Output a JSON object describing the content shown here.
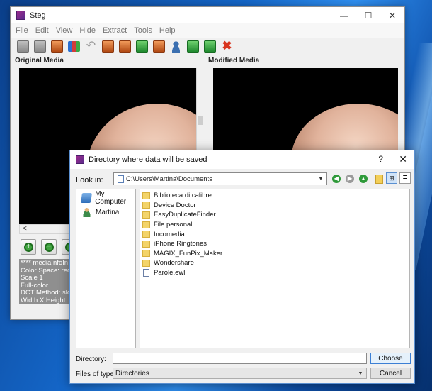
{
  "main_window": {
    "title": "Steg",
    "controls": {
      "minimize": "—",
      "maximize": "☐",
      "close": "✕"
    },
    "menu": [
      "File",
      "Edit",
      "View",
      "Hide",
      "Extract",
      "Tools",
      "Help"
    ],
    "panels": {
      "original": "Original Media",
      "modified": "Modified Media"
    },
    "info_lines": [
      "**** mediaInfoIn",
      "Color Space: red/g",
      "Scale 1",
      "Full-color",
      "DCT Method: slow",
      "Width X Height: 48"
    ],
    "hscroll_arrow": "<"
  },
  "dialog": {
    "title": "Directory where data will be saved",
    "help_glyph": "?",
    "close_glyph": "✕",
    "look_in_label": "Look in:",
    "look_in_path": "C:\\Users\\Martina\\Documents",
    "dropdown_arrow": "▼",
    "places": [
      "My Computer",
      "Martina"
    ],
    "folders": [
      "Biblioteca di calibre",
      "Device Doctor",
      "EasyDuplicateFinder",
      "File personali",
      "Incomedia",
      "iPhone Ringtones",
      "MAGIX_FunPix_Maker",
      "Wondershare"
    ],
    "files": [
      "Parole.ewl"
    ],
    "directory_label": "Directory:",
    "directory_value": "",
    "files_of_type_label": "Files of type:",
    "files_of_type_value": "Directories",
    "choose_label": "Choose",
    "cancel_label": "Cancel",
    "nav_glyphs": {
      "back": "◀",
      "forward": "▶",
      "up": "▲"
    }
  }
}
